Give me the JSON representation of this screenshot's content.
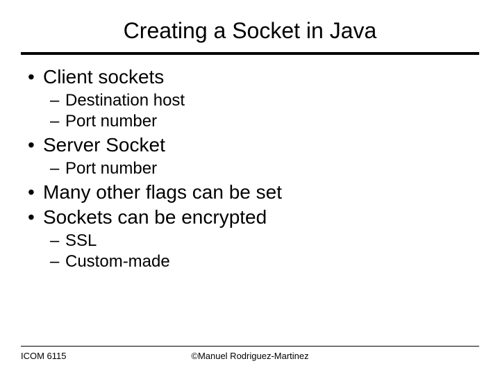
{
  "title": "Creating a Socket in Java",
  "bullets": {
    "b1": "Client sockets",
    "b1_1": "Destination host",
    "b1_2": "Port number",
    "b2": "Server Socket",
    "b2_1": "Port number",
    "b3": "Many other flags can be set",
    "b4": "Sockets can be encrypted",
    "b4_1": "SSL",
    "b4_2": "Custom-made"
  },
  "footer": {
    "left": "ICOM 6115",
    "center": "©Manuel Rodriguez-Martinez"
  }
}
